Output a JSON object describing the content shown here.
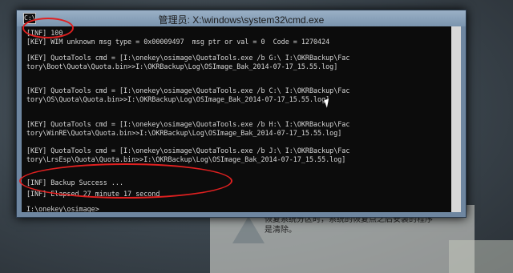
{
  "window": {
    "title": "管理员: X:\\windows\\system32\\cmd.exe",
    "icon_name": "cmd-icon",
    "icon_glyph": "C:\\"
  },
  "console_lines": [
    "[INF] 100",
    "[KEY] WIM unknown msg type = 0x00009497  msg ptr or val = 0  Code = 1270424",
    "[KEY] QuotaTools cmd = [I:\\onekey\\osimage\\QuotaTools.exe /b G:\\ I:\\OKRBackup\\Fac",
    "tory\\Boot\\Quota\\Quota.bin>>I:\\OKRBackup\\Log\\OSImage_Bak_2014-07-17_15.55.log]",
    "[KEY] QuotaTools cmd = [I:\\onekey\\osimage\\QuotaTools.exe /b C:\\ I:\\OKRBackup\\Fac",
    "tory\\OS\\Quota\\Quota.bin>>I:\\OKRBackup\\Log\\OSImage_Bak_2014-07-17_15.55.log]",
    "[KEY] QuotaTools cmd = [I:\\onekey\\osimage\\QuotaTools.exe /b H:\\ I:\\OKRBackup\\Fac",
    "tory\\WinRE\\Quota\\Quota.bin>>I:\\OKRBackup\\Log\\OSImage_Bak_2014-07-17_15.55.log]",
    "[KEY] QuotaTools cmd = [I:\\onekey\\osimage\\QuotaTools.exe /b J:\\ I:\\OKRBackup\\Fac",
    "tory\\LrsEsp\\Quota\\Quota.bin>>I:\\OKRBackup\\Log\\OSImage_Bak_2014-07-17_15.55.log]",
    "[INF] Backup Success ...",
    "[INF] Elapsed 27 minute 17 second",
    "I:\\onekey\\osimage>"
  ],
  "background_dialog": {
    "text": "恢复系统分区时，系统的恢复点之后安装的程序\n是清除。"
  }
}
